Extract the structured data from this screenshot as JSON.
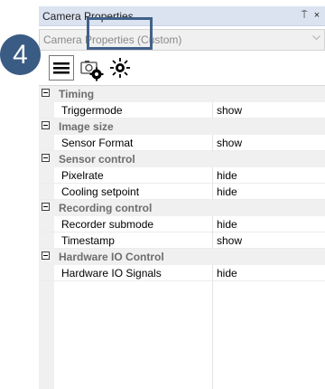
{
  "window": {
    "title": "Camera Properties",
    "pin_glyph": "⍑",
    "close_glyph": "×"
  },
  "selector": {
    "value": "Camera Properties (Custom)"
  },
  "annotation": {
    "step_number": "4"
  },
  "toolbar": {
    "icons": [
      "list-view-icon",
      "camera-settings-icon",
      "brightness-icon"
    ]
  },
  "grid": {
    "categories": [
      {
        "label": "Timing",
        "rows": [
          {
            "name": "Triggermode",
            "value": "show"
          }
        ]
      },
      {
        "label": "Image size",
        "rows": [
          {
            "name": "Sensor Format",
            "value": "show"
          }
        ]
      },
      {
        "label": "Sensor control",
        "rows": [
          {
            "name": "Pixelrate",
            "value": "hide"
          },
          {
            "name": "Cooling setpoint",
            "value": "hide"
          }
        ]
      },
      {
        "label": "Recording control",
        "rows": [
          {
            "name": "Recorder submode",
            "value": "hide"
          },
          {
            "name": "Timestamp",
            "value": "show"
          }
        ]
      },
      {
        "label": "Hardware IO Control",
        "rows": [
          {
            "name": "Hardware IO Signals",
            "value": "hide"
          }
        ]
      }
    ]
  },
  "colors": {
    "accent": "#3a5b84",
    "titlebar": "#dbe3f0",
    "category_bg": "#f0f0f0"
  }
}
